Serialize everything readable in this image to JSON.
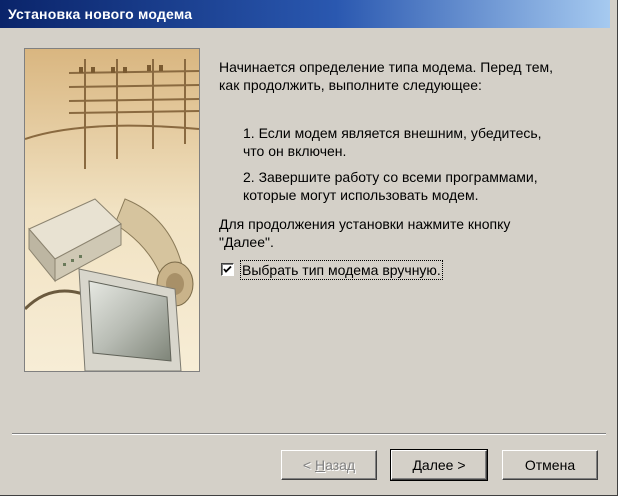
{
  "window": {
    "title": "Установка нового модема"
  },
  "content": {
    "intro_line1": "Начинается определение типа модема. Перед тем,",
    "intro_line2": "как продолжить, выполните следующее:",
    "step1_line1": "1.  Если модем является внешним, убедитесь,",
    "step1_line2": "что он включен.",
    "step2_line1": "2.  Завершите работу со всеми программами,",
    "step2_line2": "которые могут использовать модем.",
    "continue_line1": "Для продолжения установки нажмите кнопку",
    "continue_line2": "\"Далее\"."
  },
  "checkbox": {
    "label": "Выбрать тип модема вручную.",
    "checked": true
  },
  "buttons": {
    "back_prefix": "< ",
    "back_accel": "Н",
    "back_rest": "азад",
    "next_label": "Далее >",
    "cancel_label": "Отмена"
  },
  "colors": {
    "titlebar_start": "#0a246a",
    "titlebar_end": "#a6caf0",
    "dialog_bg": "#d4d0c8"
  },
  "icons": {
    "checkbox_mark": "check-mark-icon",
    "illustration": "modem-telephone-monitor-illustration"
  }
}
